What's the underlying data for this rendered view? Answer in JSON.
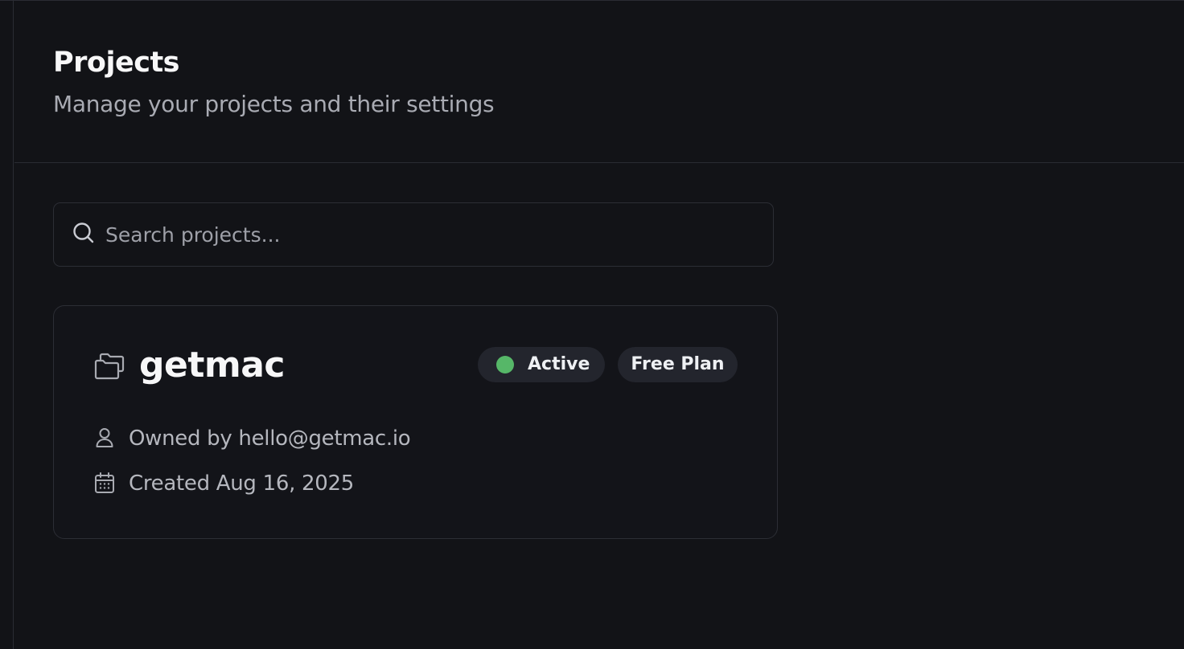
{
  "header": {
    "title": "Projects",
    "subtitle": "Manage your projects and their settings"
  },
  "search": {
    "placeholder": "Search projects...",
    "value": "",
    "icon": "search-icon"
  },
  "projects": [
    {
      "name": "getmac",
      "icon": "folder-icon",
      "status": "Active",
      "status_color": "#56b768",
      "plan": "Free Plan",
      "owner_text": "Owned by hello@getmac.io",
      "owner_icon": "user-icon",
      "created_text": "Created Aug 16, 2025",
      "created_icon": "calendar-icon"
    }
  ],
  "colors": {
    "background": "#121317",
    "border": "#2c2e35",
    "badge_background": "#23252d",
    "text_primary": "#f7f7f8",
    "text_secondary": "#a9abb3"
  }
}
